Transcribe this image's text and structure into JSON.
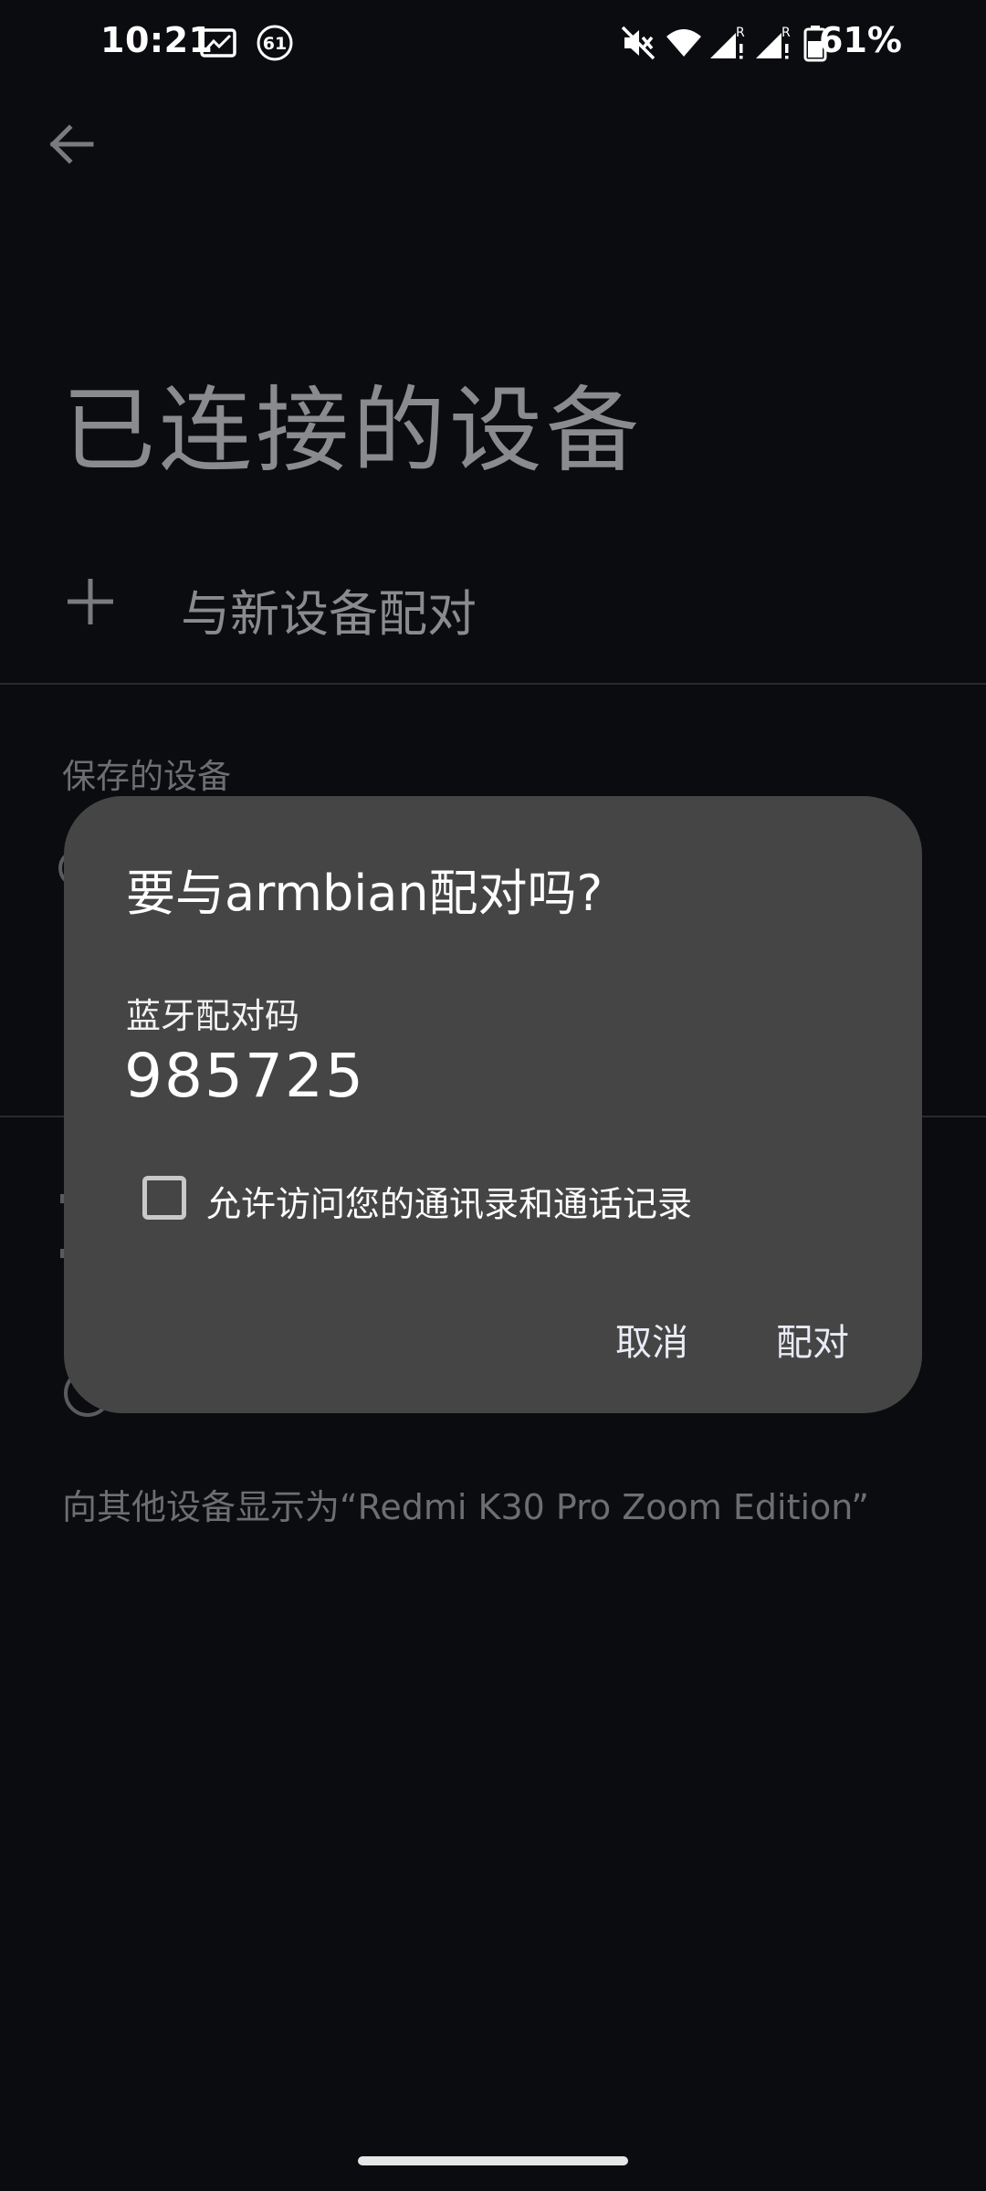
{
  "status_bar": {
    "time": "10:21",
    "notification_badge": "61",
    "battery_percent": "61%",
    "icons": [
      "screenshot-icon",
      "notification-count-icon",
      "mute-icon",
      "wifi-icon",
      "signal-1-icon",
      "signal-2-icon",
      "battery-icon"
    ]
  },
  "page": {
    "title": "已连接的设备",
    "pair_new_label": "与新设备配对",
    "saved_section_header": "保存的设备",
    "visible_as_text": "向其他设备显示为“Redmi K30 Pro Zoom Edition”"
  },
  "dialog": {
    "title": "要与armbian配对吗?",
    "code_label": "蓝牙配对码",
    "code_value": "985725",
    "checkbox_label": "允许访问您的通讯录和通话记录",
    "checkbox_checked": false,
    "cancel_label": "取消",
    "confirm_label": "配对"
  },
  "colors": {
    "background": "#0b0c0f",
    "dialog": "#454545",
    "dim_text": "#8a8b8e"
  }
}
